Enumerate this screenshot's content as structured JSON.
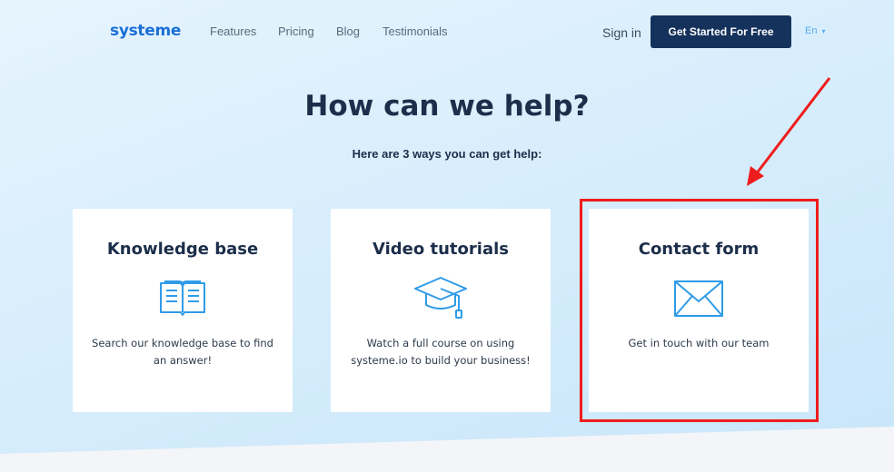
{
  "nav": {
    "logo": "systeme",
    "links": [
      "Features",
      "Pricing",
      "Blog",
      "Testimonials"
    ],
    "sign_in": "Sign in",
    "cta": "Get Started For Free",
    "language": "En",
    "language_caret": "▾"
  },
  "hero": {
    "title": "How can we help?",
    "subtitle": "Here are 3 ways you can get help:"
  },
  "cards": [
    {
      "title": "Knowledge base",
      "icon": "book-icon",
      "text": "Search our knowledge base to find an answer!"
    },
    {
      "title": "Video tutorials",
      "icon": "graduation-cap-icon",
      "text": "Watch a full course on using systeme.io to build your business!"
    },
    {
      "title": "Contact form",
      "icon": "envelope-icon",
      "text": "Get in touch with our team"
    }
  ],
  "colors": {
    "brand": "#1a6fd6",
    "cta_background": "#15325c",
    "icon": "#2f9be8",
    "annotation": "#ee1c1c"
  }
}
